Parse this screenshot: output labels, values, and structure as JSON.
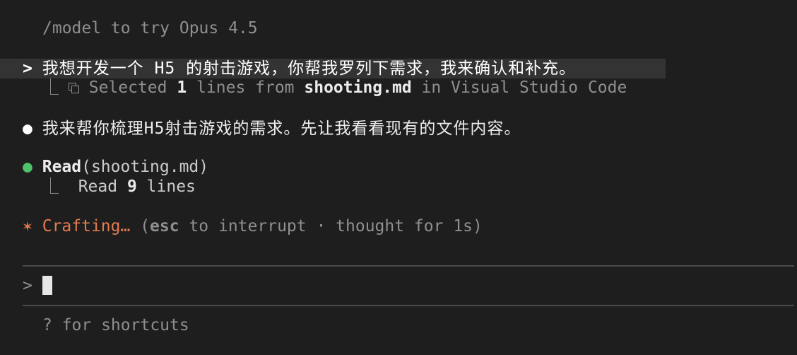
{
  "header": {
    "hint": "/model to try Opus 4.5"
  },
  "user_message": {
    "prompt": ">",
    "text": "我想开发一个 H5 的射击游戏，你帮我罗列下需求，我来确认和补充。",
    "context_prefix": "⎿",
    "context_text_1": "Selected ",
    "context_count": "1",
    "context_text_2": " lines from ",
    "context_file": "shooting.md",
    "context_text_3": " in Visual Studio Code"
  },
  "assistant_message": {
    "bullet": "●",
    "text": "我来帮你梳理H5射击游戏的需求。先让我看看现有的文件内容。"
  },
  "tool_call": {
    "bullet": "●",
    "name": "Read",
    "args": "(shooting.md)",
    "result_prefix": "⎿",
    "result_text_1": "Read ",
    "result_count": "9",
    "result_text_2": " lines"
  },
  "status": {
    "spinner": "✶",
    "label": "Crafting…",
    "paren_open": " (",
    "key": "esc",
    "hint": " to interrupt · thought for 1s)"
  },
  "input": {
    "prompt": ">",
    "value": ""
  },
  "footer": {
    "shortcuts": "? for shortcuts"
  },
  "colors": {
    "background": "#1e1e1e",
    "accent_orange": "#e47a4f",
    "bullet_green": "#4ec36a",
    "highlight_row": "#333333"
  }
}
